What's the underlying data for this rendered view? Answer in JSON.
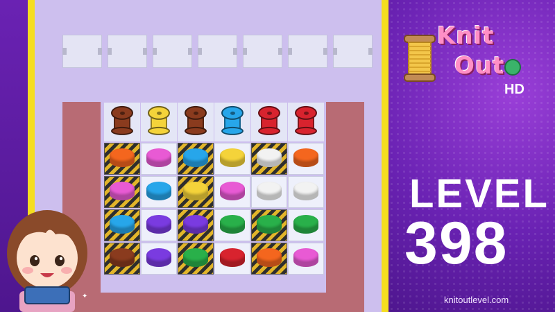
{
  "game": {
    "logo_line1": "Knit",
    "logo_line2": "Out",
    "logo_badge": "HD",
    "level_label": "LEVEL",
    "level_number": "398",
    "website": "knitoutlevel.com"
  },
  "colors": {
    "board_bg": "#cdbfee",
    "tray": "#b86b74",
    "accent_yellow": "#f5de1f",
    "purple": "#6a22b3"
  },
  "slots": {
    "count": 7,
    "state": "empty"
  },
  "spools": [
    "brown",
    "yellow",
    "brown",
    "blue",
    "red",
    "red"
  ],
  "pieces": [
    [
      {
        "c": "orange",
        "t": "hazard"
      },
      {
        "c": "magenta",
        "t": "plain"
      },
      {
        "c": "blue",
        "t": "hazard"
      },
      {
        "c": "yellow",
        "t": "plain"
      },
      {
        "c": "white",
        "t": "hazard"
      },
      {
        "c": "orange",
        "t": "plain"
      }
    ],
    [
      {
        "c": "magenta",
        "t": "hazard"
      },
      {
        "c": "blue",
        "t": "plain"
      },
      {
        "c": "yellow",
        "t": "hazard"
      },
      {
        "c": "magenta",
        "t": "plain"
      },
      {
        "c": "white",
        "t": "plain"
      },
      {
        "c": "white",
        "t": "plain"
      }
    ],
    [
      {
        "c": "blue",
        "t": "hazard"
      },
      {
        "c": "purple",
        "t": "plain"
      },
      {
        "c": "purple",
        "t": "hazard"
      },
      {
        "c": "green",
        "t": "plain"
      },
      {
        "c": "green",
        "t": "hazard"
      },
      {
        "c": "green",
        "t": "plain"
      }
    ],
    [
      {
        "c": "brown",
        "t": "hazard"
      },
      {
        "c": "purple",
        "t": "plain"
      },
      {
        "c": "green",
        "t": "hazard"
      },
      {
        "c": "red",
        "t": "plain"
      },
      {
        "c": "orange",
        "t": "hazard"
      },
      {
        "c": "magenta",
        "t": "plain"
      }
    ]
  ],
  "palette": {
    "brown": "#8a3b1e",
    "yellow": "#f4d33a",
    "blue": "#27a6ea",
    "red": "#d8232e",
    "orange": "#f4661e",
    "magenta": "#e85ad4",
    "white": "#f2f2f2",
    "purple": "#7a3be0",
    "green": "#29b04a"
  }
}
